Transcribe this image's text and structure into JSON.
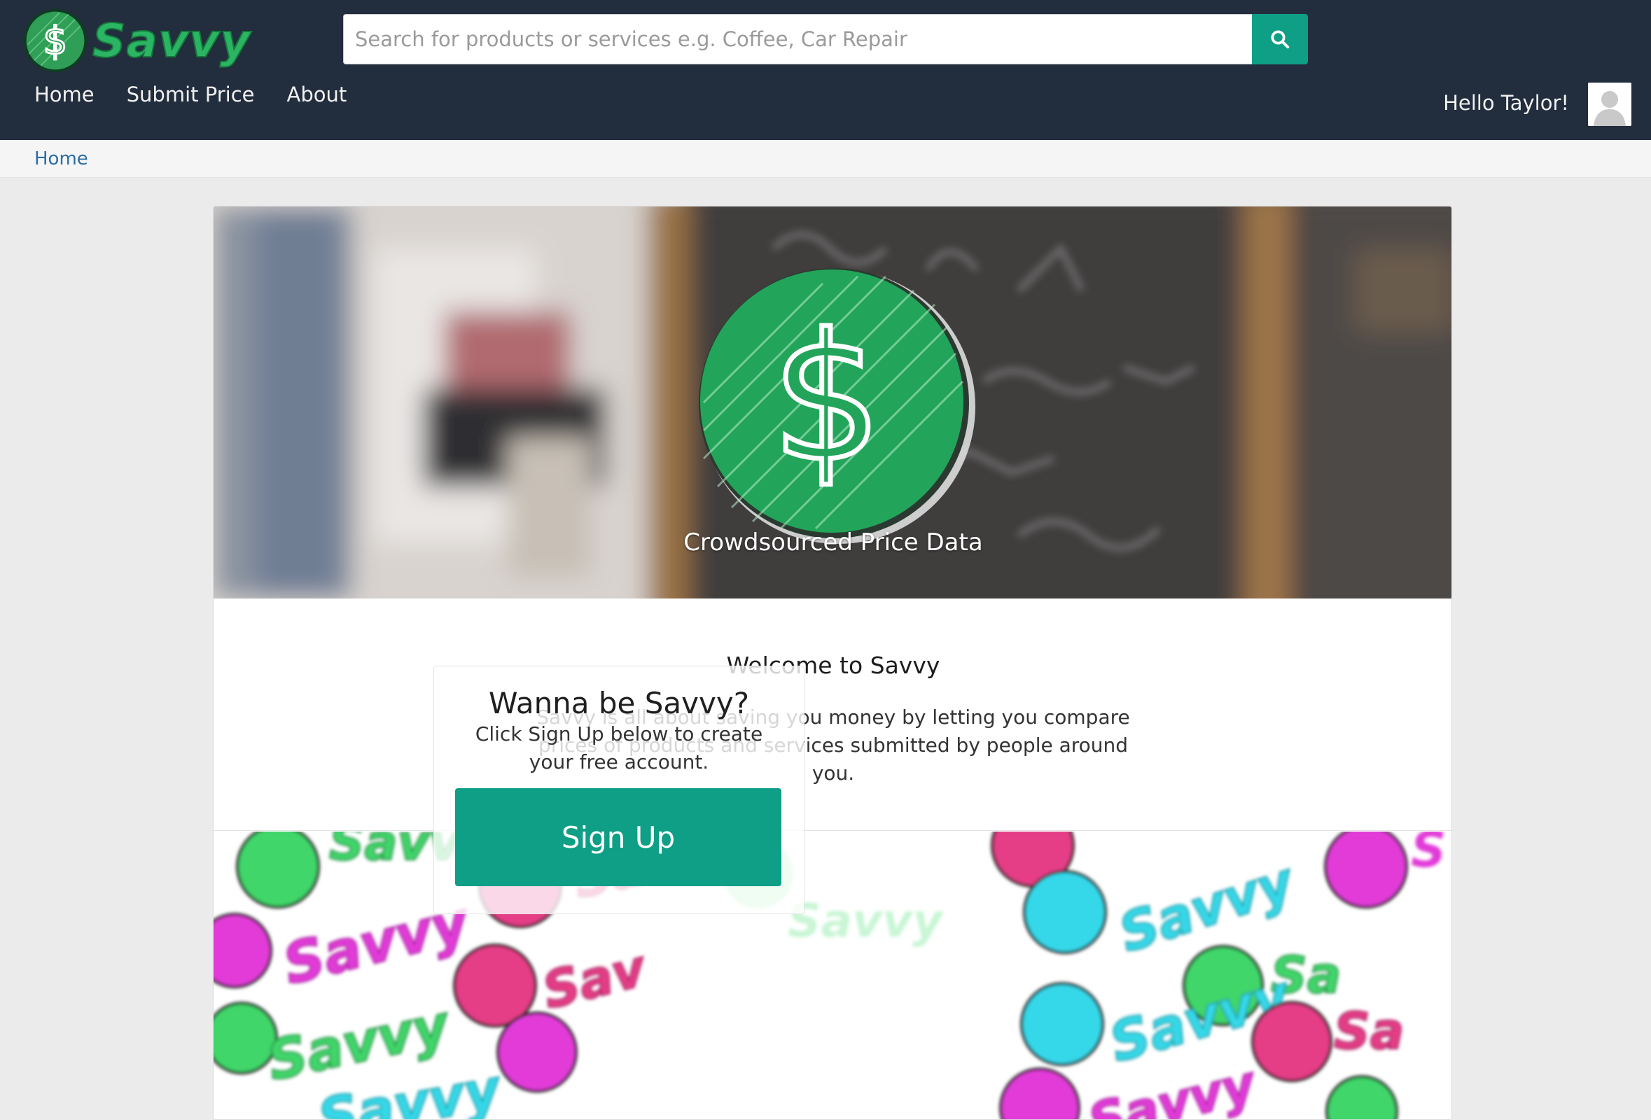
{
  "header": {
    "brand_name": "Savvy",
    "brand_color": "#2bb463",
    "bar_color": "#222d3d",
    "search": {
      "placeholder": "Search for products or services e.g. Coffee, Car Repair",
      "value": "",
      "button_icon": "search-icon",
      "button_color": "#0e9f86"
    },
    "nav": [
      {
        "label": "Home"
      },
      {
        "label": "Submit Price"
      },
      {
        "label": "About"
      }
    ],
    "greeting": "Hello Taylor!",
    "avatar_icon": "user-avatar-icon"
  },
  "breadcrumb": {
    "items": [
      {
        "label": "Home"
      }
    ]
  },
  "hero": {
    "caption": "Crowdsourced Price Data",
    "logo_icon": "dollar-coin-icon"
  },
  "welcome": {
    "title": "Welcome to Savvy",
    "body": "Savvy is all about saving you money by letting you compare prices of products and services submitted by people around you."
  },
  "signup": {
    "title": "Wanna be Savvy?",
    "text": "Click Sign Up below to create your free account.",
    "button_label": "Sign Up",
    "button_color": "#0e9f86"
  }
}
